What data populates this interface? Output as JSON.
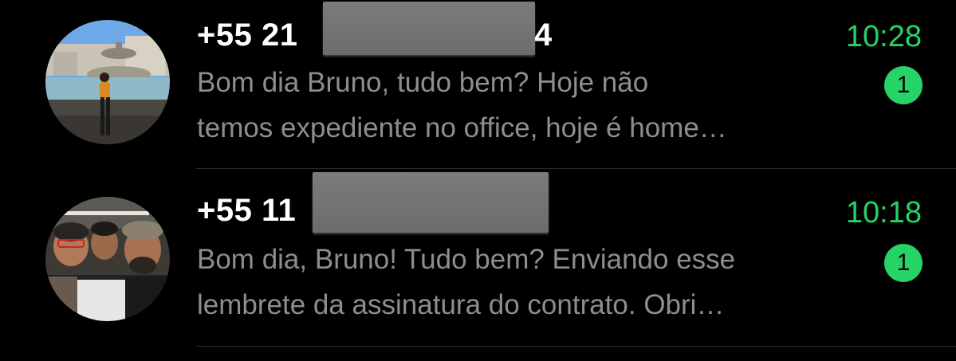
{
  "chats": [
    {
      "name_prefix": "+55 21",
      "name_suffix": "4",
      "time": "10:28",
      "preview_line1": "Bom dia Bruno, tudo bem? Hoje não",
      "preview_line2": "temos expediente no office, hoje é home…",
      "unread": "1"
    },
    {
      "name_prefix": "+55 11",
      "name_suffix": "",
      "time": "10:18",
      "preview_line1": "Bom dia, Bruno! Tudo bem? Enviando esse",
      "preview_line2": "lembrete da assinatura do contrato. Obri…",
      "unread": "1"
    }
  ],
  "colors": {
    "background": "#000000",
    "accent_green": "#25d366",
    "preview_text": "#8d8d92",
    "divider": "#2a2a2c"
  }
}
